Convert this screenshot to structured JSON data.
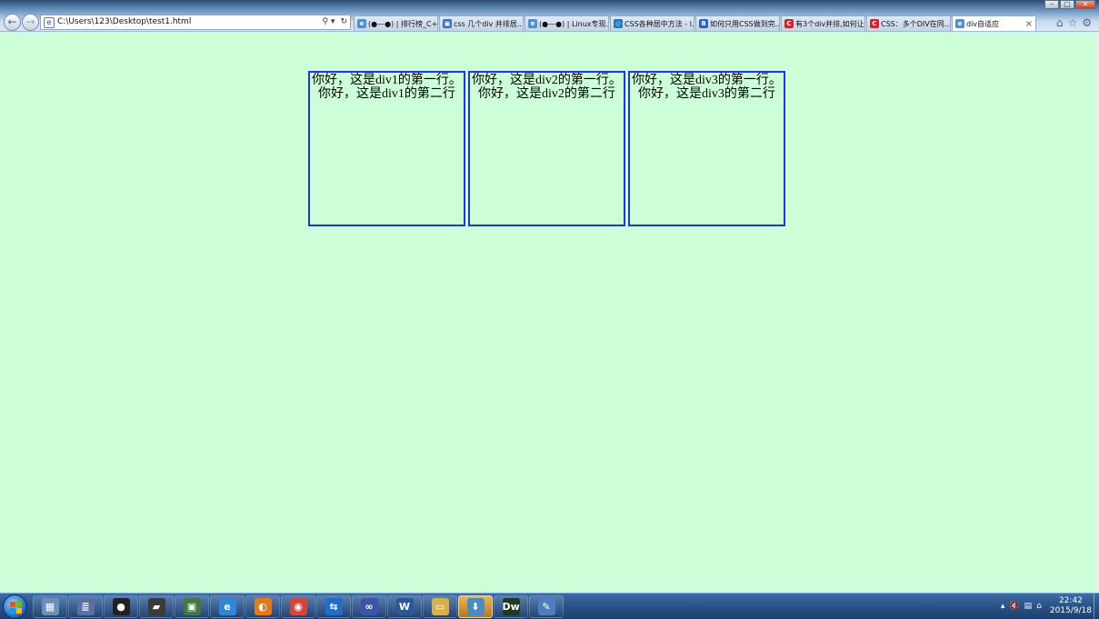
{
  "browser": {
    "address_url": "C:\\Users\\123\\Desktop\\test1.html",
    "address_tools": [
      "⚲ ▾",
      "↻"
    ],
    "tabs": [
      {
        "label": "(●—●) | 排行榜_C+...",
        "icon": "ie-icon",
        "active": false
      },
      {
        "label": "css 几个div 并排居...",
        "icon": "image-icon",
        "active": false
      },
      {
        "label": "(●—●) | Linux专现...",
        "icon": "ie-icon",
        "active": false
      },
      {
        "label": "CSS各种居中方法 - l...",
        "icon": "css-icon",
        "active": false
      },
      {
        "label": "如何只用CSS做到完...",
        "icon": "b-icon",
        "active": false
      },
      {
        "label": "有3个div并排,如何让...",
        "icon": "c-icon",
        "active": false
      },
      {
        "label": "CSS：多个DIV在同...",
        "icon": "c-icon",
        "active": false
      },
      {
        "label": "div自适应",
        "icon": "ie-icon",
        "active": true
      }
    ]
  },
  "page": {
    "background": "#ccffd7",
    "border_color": "#2032f0",
    "boxes": [
      {
        "line1": "你好，这是div1的第一行。",
        "line2": "你好，这是div1的第二行"
      },
      {
        "line1": "你好，这是div2的第一行。",
        "line2": "你好，这是div2的第二行"
      },
      {
        "line1": "你好，这是div3的第一行。",
        "line2": "你好，这是div3的第二行"
      }
    ]
  },
  "taskbar": {
    "apps": [
      {
        "name": "calculator-icon",
        "glyph": "▦",
        "color": "#6c8fb8"
      },
      {
        "name": "network-icon",
        "glyph": "≣",
        "color": "#5b6fa0"
      },
      {
        "name": "qq-icon",
        "glyph": "●",
        "color": "#222222"
      },
      {
        "name": "book-icon",
        "glyph": "▰",
        "color": "#3a3a3a"
      },
      {
        "name": "monitor-icon",
        "glyph": "▣",
        "color": "#3f7a3f"
      },
      {
        "name": "ie-icon",
        "glyph": "e",
        "color": "#2f86d8"
      },
      {
        "name": "firefox-icon",
        "glyph": "◐",
        "color": "#e07b20"
      },
      {
        "name": "chrome-icon",
        "glyph": "◉",
        "color": "#d6453a"
      },
      {
        "name": "teamviewer-icon",
        "glyph": "⇆",
        "color": "#1f6fc8"
      },
      {
        "name": "infinity-icon",
        "glyph": "∞",
        "color": "#3d54a8"
      },
      {
        "name": "word-icon",
        "glyph": "W",
        "color": "#2b5797"
      },
      {
        "name": "folder-icon",
        "glyph": "▭",
        "color": "#d8b04a"
      },
      {
        "name": "download-icon",
        "glyph": "⬇",
        "color": "#4a8bc0"
      },
      {
        "name": "dreamweaver-icon",
        "glyph": "Dw",
        "color": "#1f3b1f"
      },
      {
        "name": "paint-icon",
        "glyph": "✎",
        "color": "#4d7fc0"
      }
    ],
    "active_app_index": 12,
    "tray": [
      "▴",
      "🔇",
      "▤",
      "⌂"
    ],
    "time": "22:42",
    "date": "2015/9/18"
  }
}
